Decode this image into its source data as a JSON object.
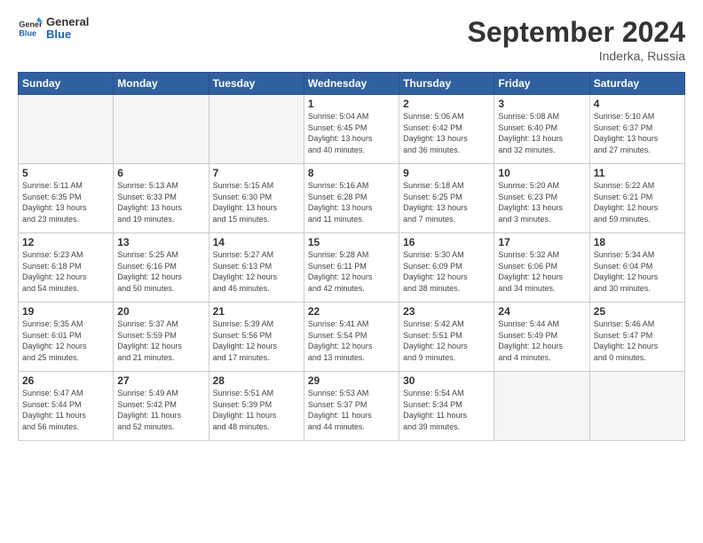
{
  "header": {
    "logo_line1": "General",
    "logo_line2": "Blue",
    "month": "September 2024",
    "location": "Inderka, Russia"
  },
  "weekdays": [
    "Sunday",
    "Monday",
    "Tuesday",
    "Wednesday",
    "Thursday",
    "Friday",
    "Saturday"
  ],
  "days": [
    {
      "num": "",
      "info": ""
    },
    {
      "num": "",
      "info": ""
    },
    {
      "num": "",
      "info": ""
    },
    {
      "num": "1",
      "info": "Sunrise: 5:04 AM\nSunset: 6:45 PM\nDaylight: 13 hours\nand 40 minutes."
    },
    {
      "num": "2",
      "info": "Sunrise: 5:06 AM\nSunset: 6:42 PM\nDaylight: 13 hours\nand 36 minutes."
    },
    {
      "num": "3",
      "info": "Sunrise: 5:08 AM\nSunset: 6:40 PM\nDaylight: 13 hours\nand 32 minutes."
    },
    {
      "num": "4",
      "info": "Sunrise: 5:10 AM\nSunset: 6:37 PM\nDaylight: 13 hours\nand 27 minutes."
    },
    {
      "num": "5",
      "info": "Sunrise: 5:11 AM\nSunset: 6:35 PM\nDaylight: 13 hours\nand 23 minutes."
    },
    {
      "num": "6",
      "info": "Sunrise: 5:13 AM\nSunset: 6:33 PM\nDaylight: 13 hours\nand 19 minutes."
    },
    {
      "num": "7",
      "info": "Sunrise: 5:15 AM\nSunset: 6:30 PM\nDaylight: 13 hours\nand 15 minutes."
    },
    {
      "num": "8",
      "info": "Sunrise: 5:16 AM\nSunset: 6:28 PM\nDaylight: 13 hours\nand 11 minutes."
    },
    {
      "num": "9",
      "info": "Sunrise: 5:18 AM\nSunset: 6:25 PM\nDaylight: 13 hours\nand 7 minutes."
    },
    {
      "num": "10",
      "info": "Sunrise: 5:20 AM\nSunset: 6:23 PM\nDaylight: 13 hours\nand 3 minutes."
    },
    {
      "num": "11",
      "info": "Sunrise: 5:22 AM\nSunset: 6:21 PM\nDaylight: 12 hours\nand 59 minutes."
    },
    {
      "num": "12",
      "info": "Sunrise: 5:23 AM\nSunset: 6:18 PM\nDaylight: 12 hours\nand 54 minutes."
    },
    {
      "num": "13",
      "info": "Sunrise: 5:25 AM\nSunset: 6:16 PM\nDaylight: 12 hours\nand 50 minutes."
    },
    {
      "num": "14",
      "info": "Sunrise: 5:27 AM\nSunset: 6:13 PM\nDaylight: 12 hours\nand 46 minutes."
    },
    {
      "num": "15",
      "info": "Sunrise: 5:28 AM\nSunset: 6:11 PM\nDaylight: 12 hours\nand 42 minutes."
    },
    {
      "num": "16",
      "info": "Sunrise: 5:30 AM\nSunset: 6:09 PM\nDaylight: 12 hours\nand 38 minutes."
    },
    {
      "num": "17",
      "info": "Sunrise: 5:32 AM\nSunset: 6:06 PM\nDaylight: 12 hours\nand 34 minutes."
    },
    {
      "num": "18",
      "info": "Sunrise: 5:34 AM\nSunset: 6:04 PM\nDaylight: 12 hours\nand 30 minutes."
    },
    {
      "num": "19",
      "info": "Sunrise: 5:35 AM\nSunset: 6:01 PM\nDaylight: 12 hours\nand 25 minutes."
    },
    {
      "num": "20",
      "info": "Sunrise: 5:37 AM\nSunset: 5:59 PM\nDaylight: 12 hours\nand 21 minutes."
    },
    {
      "num": "21",
      "info": "Sunrise: 5:39 AM\nSunset: 5:56 PM\nDaylight: 12 hours\nand 17 minutes."
    },
    {
      "num": "22",
      "info": "Sunrise: 5:41 AM\nSunset: 5:54 PM\nDaylight: 12 hours\nand 13 minutes."
    },
    {
      "num": "23",
      "info": "Sunrise: 5:42 AM\nSunset: 5:51 PM\nDaylight: 12 hours\nand 9 minutes."
    },
    {
      "num": "24",
      "info": "Sunrise: 5:44 AM\nSunset: 5:49 PM\nDaylight: 12 hours\nand 4 minutes."
    },
    {
      "num": "25",
      "info": "Sunrise: 5:46 AM\nSunset: 5:47 PM\nDaylight: 12 hours\nand 0 minutes."
    },
    {
      "num": "26",
      "info": "Sunrise: 5:47 AM\nSunset: 5:44 PM\nDaylight: 11 hours\nand 56 minutes."
    },
    {
      "num": "27",
      "info": "Sunrise: 5:49 AM\nSunset: 5:42 PM\nDaylight: 11 hours\nand 52 minutes."
    },
    {
      "num": "28",
      "info": "Sunrise: 5:51 AM\nSunset: 5:39 PM\nDaylight: 11 hours\nand 48 minutes."
    },
    {
      "num": "29",
      "info": "Sunrise: 5:53 AM\nSunset: 5:37 PM\nDaylight: 11 hours\nand 44 minutes."
    },
    {
      "num": "30",
      "info": "Sunrise: 5:54 AM\nSunset: 5:34 PM\nDaylight: 11 hours\nand 39 minutes."
    },
    {
      "num": "",
      "info": ""
    },
    {
      "num": "",
      "info": ""
    },
    {
      "num": "",
      "info": ""
    },
    {
      "num": "",
      "info": ""
    },
    {
      "num": "",
      "info": ""
    }
  ]
}
